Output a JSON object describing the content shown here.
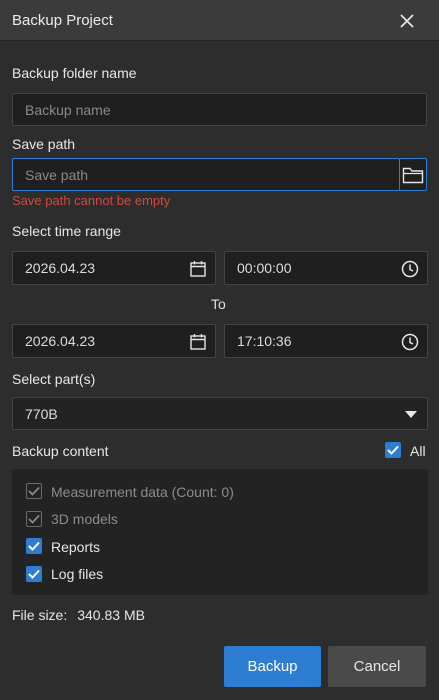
{
  "dialog": {
    "title": "Backup Project"
  },
  "form": {
    "folder_name_label": "Backup folder name",
    "folder_name_placeholder": "Backup name",
    "save_path_label": "Save path",
    "save_path_placeholder": "Save path",
    "save_path_error": "Save path cannot be empty",
    "time_range_label": "Select time range",
    "start_date": "2026.04.23",
    "start_time": "00:00:00",
    "to_label": "To",
    "end_date": "2026.04.23",
    "end_time": "17:10:36",
    "parts_label": "Select part(s)",
    "selected_part": "770B"
  },
  "backup_content": {
    "label": "Backup content",
    "all_label": "All",
    "all_checked": true,
    "items": [
      {
        "label": "Measurement data (Count: 0)",
        "checked": true,
        "disabled": true
      },
      {
        "label": "3D models",
        "checked": true,
        "disabled": true
      },
      {
        "label": "Reports",
        "checked": true,
        "disabled": false
      },
      {
        "label": "Log files",
        "checked": true,
        "disabled": false
      }
    ]
  },
  "file_size": {
    "label": "File size:",
    "value": "340.83 MB"
  },
  "buttons": {
    "backup": "Backup",
    "cancel": "Cancel"
  },
  "colors": {
    "accent": "#2d7dd2",
    "error": "#d04a3c",
    "background": "#2d2d2d"
  }
}
